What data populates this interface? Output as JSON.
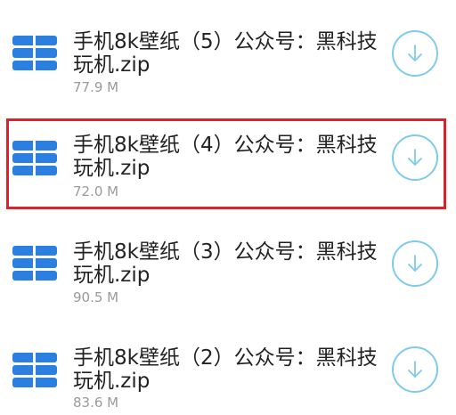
{
  "files": [
    {
      "name": "手机8k壁纸（5）公众号：黑科技玩机.zip",
      "size": "77.9 M",
      "icon": "zip-archive-icon",
      "action_icon": "download-icon"
    },
    {
      "name": "手机8k壁纸（4）公众号：黑科技玩机.zip",
      "size": "72.0 M",
      "icon": "zip-archive-icon",
      "action_icon": "download-icon",
      "highlighted": true
    },
    {
      "name": "手机8k壁纸（3）公众号：黑科技玩机.zip",
      "size": "90.5 M",
      "icon": "zip-archive-icon",
      "action_icon": "download-icon"
    },
    {
      "name": "手机8k壁纸（2）公众号：黑科技玩机.zip",
      "size": "83.6 M",
      "icon": "zip-archive-icon",
      "action_icon": "download-icon"
    }
  ],
  "colors": {
    "icon_blue": "#2a7fe0",
    "download_ring": "#7ecbea",
    "highlight_border": "#d8232a",
    "name_text": "#222222",
    "size_text": "#9a9a9a"
  }
}
